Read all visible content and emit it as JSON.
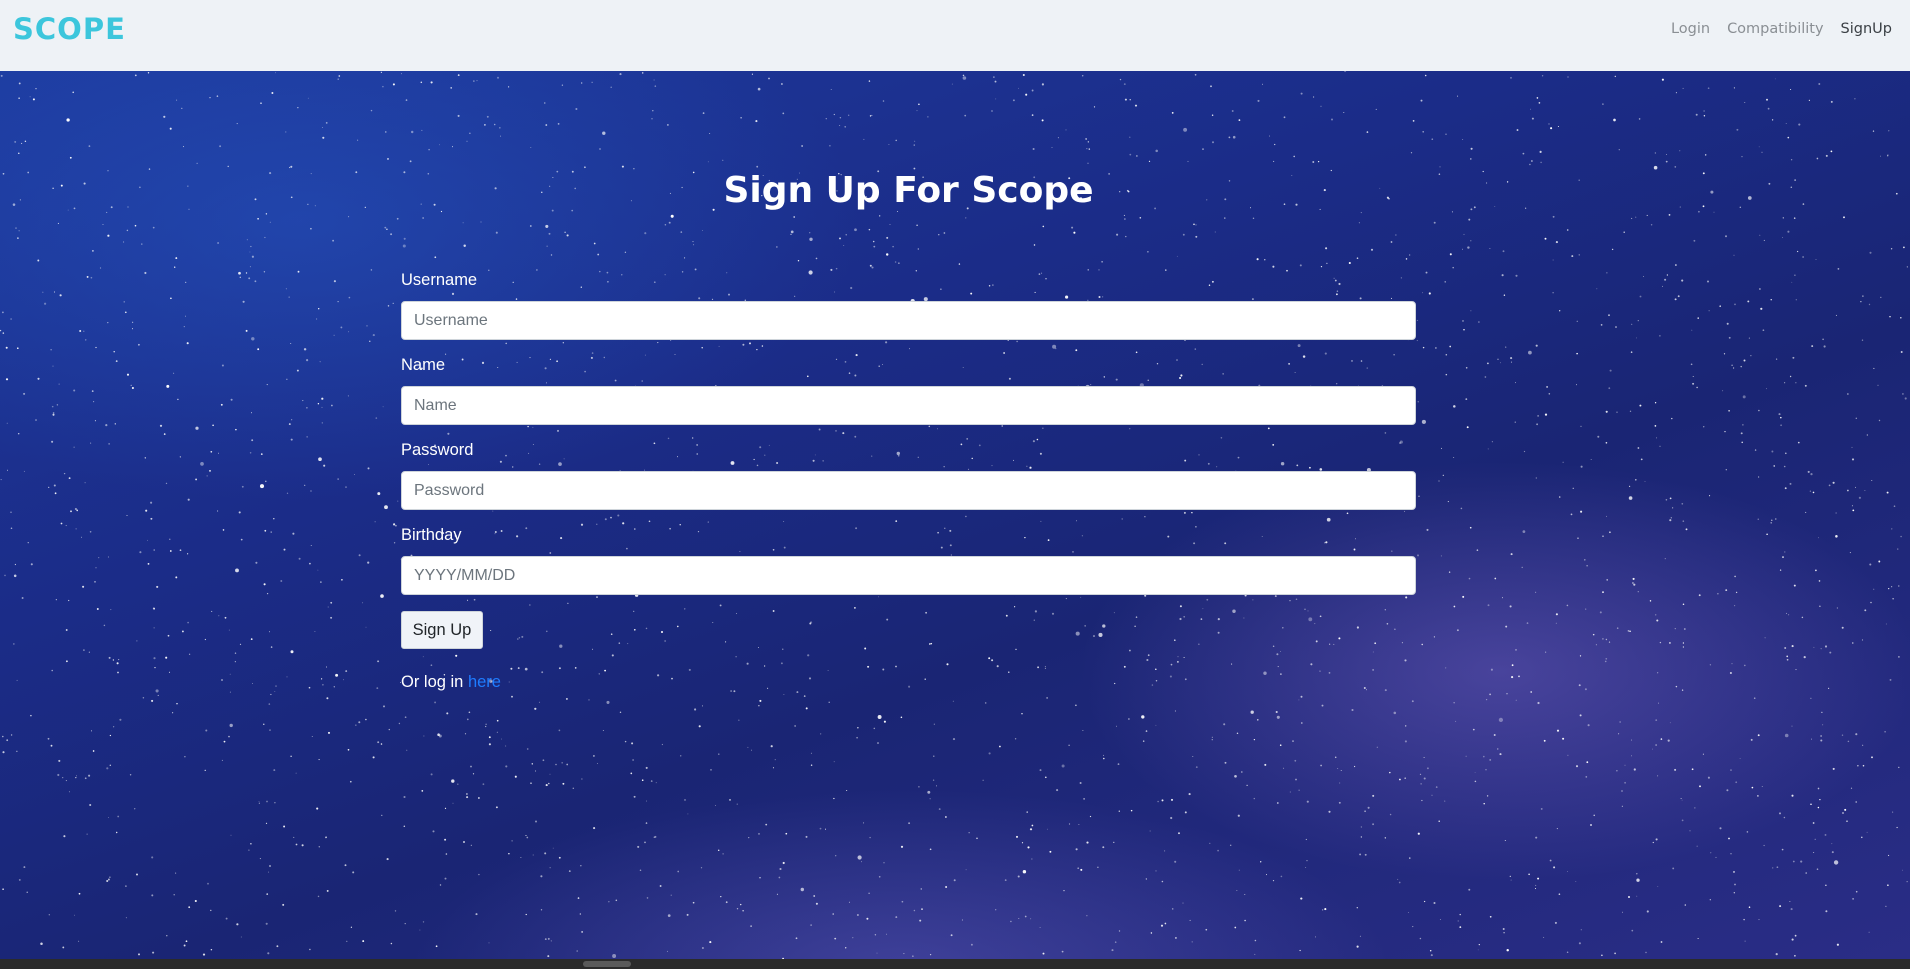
{
  "navbar": {
    "brand": "SCOPE",
    "links": [
      {
        "label": "Login",
        "active": false
      },
      {
        "label": "Compatibility",
        "active": false
      },
      {
        "label": "SignUp",
        "active": true
      }
    ]
  },
  "form": {
    "title": "Sign Up For Scope",
    "fields": [
      {
        "label": "Username",
        "placeholder": "Username",
        "value": ""
      },
      {
        "label": "Name",
        "placeholder": "Name",
        "value": ""
      },
      {
        "label": "Password",
        "placeholder": "Password",
        "value": ""
      },
      {
        "label": "Birthday",
        "placeholder": "YYYY/MM/DD",
        "value": ""
      }
    ],
    "submit_label": "Sign Up",
    "login_prompt": "Or log in ",
    "login_link": "here"
  },
  "colors": {
    "brand": "#3cc6dc",
    "navbar_bg": "#eef2f6",
    "link": "#1e7cff",
    "background": "#1a2a80"
  }
}
